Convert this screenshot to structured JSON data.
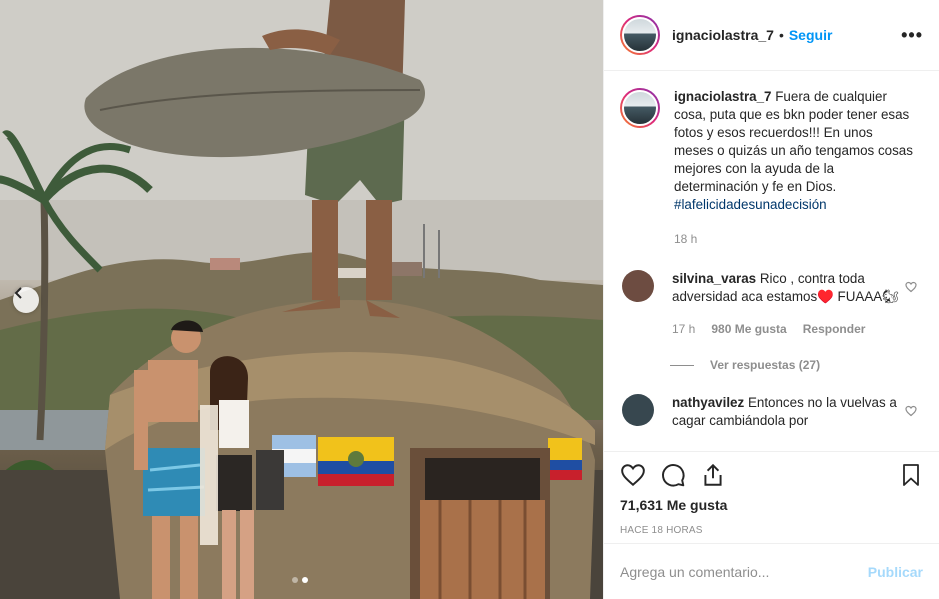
{
  "post": {
    "photo_alt": "",
    "carousel": {
      "total": 2,
      "active_index": 1
    }
  },
  "header": {
    "username": "ignaciolastra_7",
    "separator": "•",
    "follow_label": "Seguir",
    "more_label": "•••"
  },
  "caption": {
    "username": "ignaciolastra_7",
    "text": "Fuera de cualquier cosa, puta que es bkn poder tener esas fotos y esos recuerdos!!! En unos meses o quizás un año tengamos cosas mejores con la ayuda de la determinación y fe en Dios.",
    "hashtag": "#lafelicidadesunadecisión",
    "time": "18 h"
  },
  "comments": [
    {
      "username": "silvina_varas",
      "text": "Rico , contra toda adversidad aca estamos♥️ FUAAA🐿",
      "time": "17 h",
      "likes": "980 Me gusta",
      "reply_label": "Responder",
      "view_replies": "Ver respuestas (27)",
      "avatar_color": "#6d4c41"
    },
    {
      "username": "nathyavilez",
      "text": "Entonces no la vuelvas a cagar cambiándola por",
      "avatar_color": "#37474f"
    }
  ],
  "actions": {
    "icons": [
      "heart-icon",
      "comment-icon",
      "share-icon",
      "bookmark-icon"
    ],
    "likes_count": "71,631 Me gusta",
    "time_ago": "HACE 18 HORAS"
  },
  "add_comment": {
    "placeholder": "Agrega un comentario...",
    "publish_label": "Publicar"
  },
  "colors": {
    "accent": "#0095f6",
    "muted": "#8e8e8e",
    "text": "#262626",
    "hashtag": "#00376b"
  }
}
